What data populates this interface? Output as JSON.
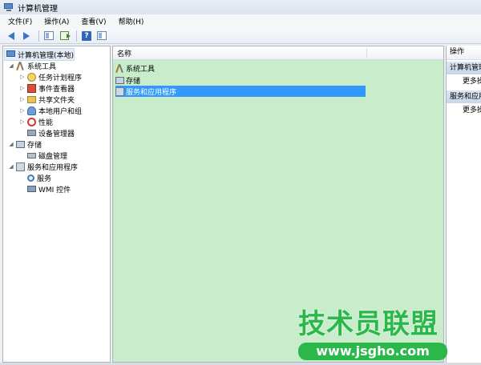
{
  "window": {
    "title": "计算机管理"
  },
  "menu": [
    "文件(F)",
    "操作(A)",
    "查看(V)",
    "帮助(H)"
  ],
  "toolbar": {
    "buttons": [
      "back-icon",
      "forward-icon",
      "show-console-tree-icon",
      "export-list-icon",
      "help-icon",
      "show-action-pane-icon"
    ],
    "help_label": "?"
  },
  "tree": {
    "root": "计算机管理(本地)",
    "system_tools": "系统工具",
    "task_scheduler": "任务计划程序",
    "event_viewer": "事件查看器",
    "shared_folders": "共享文件夹",
    "local_users": "本地用户和组",
    "performance": "性能",
    "device_manager": "设备管理器",
    "storage": "存储",
    "disk_management": "磁盘管理",
    "services_apps": "服务和应用程序",
    "services": "服务",
    "wmi": "WMI 控件",
    "expander_collapsed": "▷",
    "expander_expanded": "◢"
  },
  "list": {
    "column_name": "名称",
    "items": [
      "系统工具",
      "存储",
      "服务和应用程序"
    ],
    "selected_index": 2
  },
  "actions": {
    "header": "操作",
    "section1": "计算机管理",
    "more1": "更多操作",
    "section2": "服务和应用程序",
    "more2": "更多操作"
  },
  "watermark": {
    "title": "技术员联盟",
    "url": "www.jsgho.com"
  },
  "colors": {
    "content_bg": "#c9eccb",
    "selection": "#3399ff",
    "watermark": "#2bb84b"
  }
}
